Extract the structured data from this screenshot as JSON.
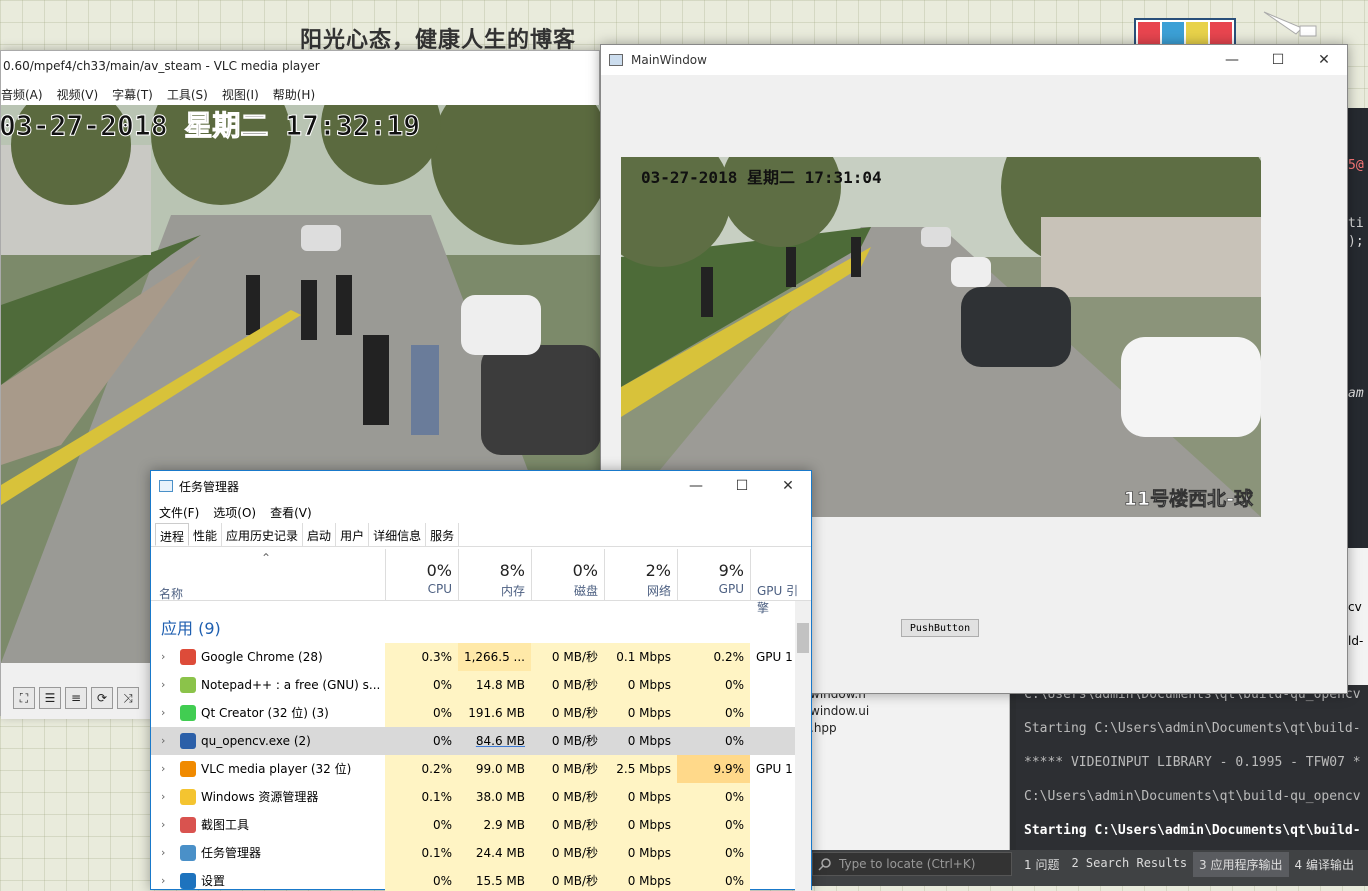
{
  "background": {
    "blog_title": "阳光心态，健康人生的博客"
  },
  "vlc": {
    "title": "0.60/mpef4/ch33/main/av_steam - VLC media player",
    "menu": [
      "音频(A)",
      "视频(V)",
      "字幕(T)",
      "工具(S)",
      "视图(I)",
      "帮助(H)"
    ],
    "timestamp": "03-27-2018  星期二  17:32:19"
  },
  "mainwindow": {
    "title": "MainWindow",
    "timestamp": "03-27-2018  星期二  17:31:04",
    "camera_label": "11号楼西北-球",
    "push_button": "PushButton",
    "accent": "#3c7bd6"
  },
  "qt": {
    "locate_placeholder": "Type to locate (Ctrl+K)",
    "output_tabs": [
      "1  问题",
      "2  Search Results",
      "3  应用程序输出",
      "4  编译输出"
    ],
    "output_lines": [
      "C:\\Users\\admin\\Documents\\qt\\build-qu_opencv",
      "Starting C:\\Users\\admin\\Documents\\qt\\build-",
      "***** VIDEOINPUT LIBRARY - 0.1995 - TFW07 *",
      "C:\\Users\\admin\\Documents\\qt\\build-qu_opencv",
      "Starting C:\\Users\\admin\\Documents\\qt\\build-"
    ],
    "files": [
      "window.h",
      "window.ui",
      ".hpp"
    ],
    "editor_fragments": [
      "5@",
      "ti",
      ");",
      "am"
    ],
    "right_fragments": [
      "cv",
      "ld-"
    ]
  },
  "taskmanager": {
    "title": "任务管理器",
    "menu": [
      "文件(F)",
      "选项(O)",
      "查看(V)"
    ],
    "tabs": [
      "进程",
      "性能",
      "应用历史记录",
      "启动",
      "用户",
      "详细信息",
      "服务"
    ],
    "columns": {
      "name": "名称",
      "cpu": {
        "pct": "0%",
        "label": "CPU"
      },
      "mem": {
        "pct": "8%",
        "label": "内存"
      },
      "disk": {
        "pct": "0%",
        "label": "磁盘"
      },
      "net": {
        "pct": "2%",
        "label": "网络"
      },
      "gpu": {
        "pct": "9%",
        "label": "GPU"
      },
      "gpu_engine": {
        "label": "GPU 引擎"
      }
    },
    "group": "应用 (9)",
    "rows": [
      {
        "name": "Google Chrome (28)",
        "cpu": "0.3%",
        "mem": "1,266.5 ...",
        "disk": "0 MB/秒",
        "net": "0.1 Mbps",
        "gpu": "0.2%",
        "engine": "GPU 1",
        "icon": "chrome-icon",
        "color": "#dd4b39"
      },
      {
        "name": "Notepad++ : a free (GNU) s...",
        "cpu": "0%",
        "mem": "14.8 MB",
        "disk": "0 MB/秒",
        "net": "0 Mbps",
        "gpu": "0%",
        "engine": "",
        "icon": "notepad-icon",
        "color": "#8bc34a"
      },
      {
        "name": "Qt Creator (32 位) (3)",
        "cpu": "0%",
        "mem": "191.6 MB",
        "disk": "0 MB/秒",
        "net": "0 Mbps",
        "gpu": "0%",
        "engine": "",
        "icon": "qt-icon",
        "color": "#41cd52"
      },
      {
        "name": "qu_opencv.exe (2)",
        "cpu": "0%",
        "mem": "84.6 MB",
        "disk": "0 MB/秒",
        "net": "0 Mbps",
        "gpu": "0%",
        "engine": "",
        "icon": "app-icon",
        "color": "#2b5fa8"
      },
      {
        "name": "VLC media player (32 位)",
        "cpu": "0.2%",
        "mem": "99.0 MB",
        "disk": "0 MB/秒",
        "net": "2.5 Mbps",
        "gpu": "9.9%",
        "engine": "GPU 1",
        "icon": "vlc-icon",
        "color": "#f08a00"
      },
      {
        "name": "Windows 资源管理器",
        "cpu": "0.1%",
        "mem": "38.0 MB",
        "disk": "0 MB/秒",
        "net": "0 Mbps",
        "gpu": "0%",
        "engine": "",
        "icon": "explorer-icon",
        "color": "#f4c430"
      },
      {
        "name": "截图工具",
        "cpu": "0%",
        "mem": "2.9 MB",
        "disk": "0 MB/秒",
        "net": "0 Mbps",
        "gpu": "0%",
        "engine": "",
        "icon": "snipping-icon",
        "color": "#d9534f"
      },
      {
        "name": "任务管理器",
        "cpu": "0.1%",
        "mem": "24.4 MB",
        "disk": "0 MB/秒",
        "net": "0 Mbps",
        "gpu": "0%",
        "engine": "",
        "icon": "taskmgr-icon",
        "color": "#4a90c8"
      },
      {
        "name": "设置",
        "cpu": "0%",
        "mem": "15.5 MB",
        "disk": "0 MB/秒",
        "net": "0 Mbps",
        "gpu": "0%",
        "engine": "",
        "icon": "settings-icon",
        "color": "#1e73be"
      }
    ]
  }
}
